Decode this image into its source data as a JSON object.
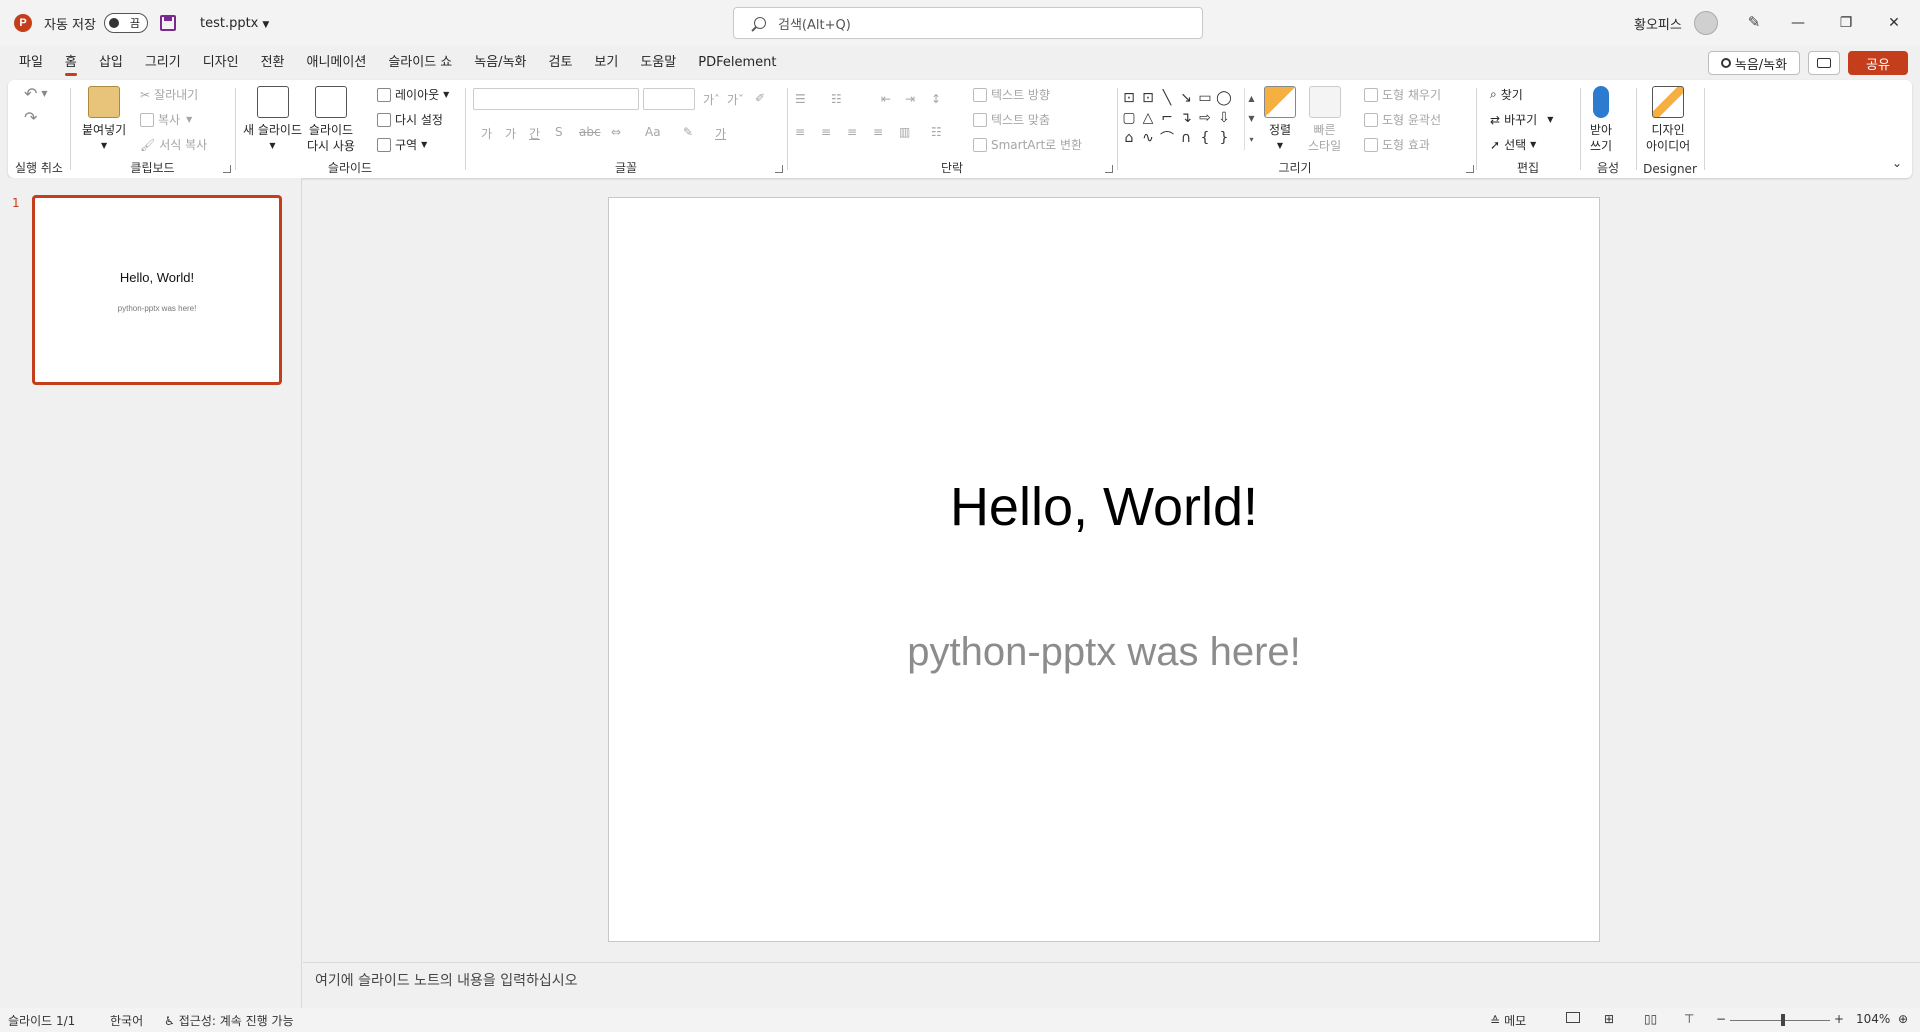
{
  "titlebar": {
    "app_icon": "P",
    "autosave_label": "자동 저장",
    "autosave_state": "끔",
    "filename": "test.pptx",
    "search_placeholder": "검색(Alt+Q)",
    "user_name": "황오피스"
  },
  "tabs": [
    "파일",
    "홈",
    "삽입",
    "그리기",
    "디자인",
    "전환",
    "애니메이션",
    "슬라이드 쇼",
    "녹음/녹화",
    "검토",
    "보기",
    "도움말",
    "PDFelement"
  ],
  "active_tab": "홈",
  "tab_actions": {
    "record": "녹음/녹화",
    "share": "공유"
  },
  "ribbon": {
    "undo": {
      "label": "실행 취소"
    },
    "clipboard": {
      "label": "클립보드",
      "paste": "붙여넣기",
      "cut": "잘라내기",
      "copy": "복사",
      "format_painter": "서식 복사"
    },
    "slides": {
      "label": "슬라이드",
      "new_slide": "새 슬라이드",
      "reuse_1": "슬라이드",
      "reuse_2": "다시 사용",
      "layout": "레이아웃",
      "reset": "다시 설정",
      "section": "구역"
    },
    "font": {
      "label": "글꼴"
    },
    "paragraph": {
      "label": "단락",
      "text_direction": "텍스트 방향",
      "align_text": "텍스트 맞춤",
      "smartart": "SmartArt로 변환"
    },
    "drawing": {
      "label": "그리기",
      "arrange": "정렬",
      "quick_1": "빠른",
      "quick_2": "스타일",
      "fill": "도형 채우기",
      "outline": "도형 윤곽선",
      "effects": "도형 효과"
    },
    "editing": {
      "label": "편집",
      "find": "찾기",
      "replace": "바꾸기",
      "select": "선택"
    },
    "voice": {
      "label": "음성",
      "dictate_1": "받아",
      "dictate_2": "쓰기"
    },
    "designer": {
      "label": "Designer",
      "ideas_1": "디자인",
      "ideas_2": "아이디어"
    }
  },
  "thumbnails": [
    {
      "number": "1",
      "title": "Hello, World!",
      "subtitle": "python-pptx was here!"
    }
  ],
  "slide": {
    "title": "Hello, World!",
    "subtitle": "python-pptx was here!"
  },
  "notes_placeholder": "여기에 슬라이드 노트의 내용을 입력하십시오",
  "statusbar": {
    "slide_counter": "슬라이드 1/1",
    "language": "한국어",
    "accessibility": "접근성: 계속 진행 가능",
    "notes": "메모",
    "zoom_minus": "−",
    "zoom_plus": "+",
    "zoom": "104%"
  },
  "colors": {
    "accent": "#c43e1c",
    "ribbon_bg": "#ffffff",
    "app_bg": "#f0f0f0"
  }
}
